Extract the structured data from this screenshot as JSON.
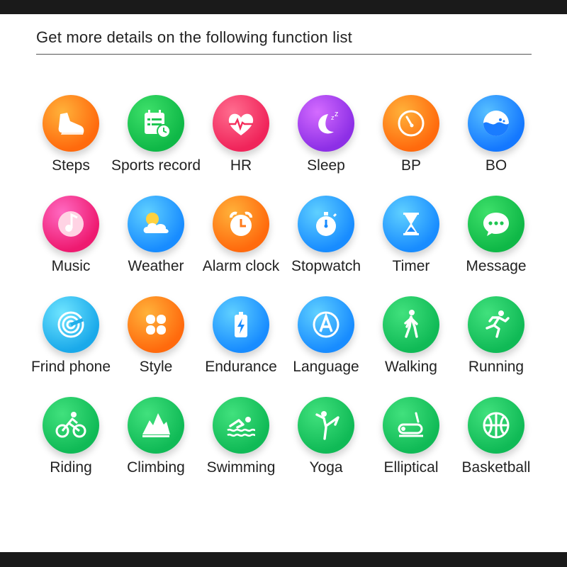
{
  "header": {
    "title": "Get more details on the following function list"
  },
  "functions": [
    {
      "label": "Steps",
      "icon": "shoe-icon",
      "color": "#ff7a1a"
    },
    {
      "label": "Sports record",
      "icon": "calendar-record-icon",
      "color": "#1fc652"
    },
    {
      "label": "HR",
      "icon": "heart-rate-icon",
      "color": "#f42d5c"
    },
    {
      "label": "Sleep",
      "icon": "moon-sleep-icon",
      "color": "#a23df0"
    },
    {
      "label": "BP",
      "icon": "gauge-icon",
      "color": "#ff7a1a"
    },
    {
      "label": "BO",
      "icon": "blood-oxygen-icon",
      "color": "#1a7cff"
    },
    {
      "label": "Music",
      "icon": "music-note-icon",
      "color": "#f02478"
    },
    {
      "label": "Weather",
      "icon": "sun-cloud-icon",
      "color": "#2a95ff"
    },
    {
      "label": "Alarm clock",
      "icon": "alarm-clock-icon",
      "color": "#ff7a1a"
    },
    {
      "label": "Stopwatch",
      "icon": "stopwatch-icon",
      "color": "#1a8cff"
    },
    {
      "label": "Timer",
      "icon": "hourglass-icon",
      "color": "#1a8cff"
    },
    {
      "label": "Message",
      "icon": "chat-bubble-icon",
      "color": "#1fc652"
    },
    {
      "label": "Frind phone",
      "icon": "radar-icon",
      "color": "#22aeea"
    },
    {
      "label": "Style",
      "icon": "clover-icon",
      "color": "#ff6a0d"
    },
    {
      "label": "Endurance",
      "icon": "battery-icon",
      "color": "#1a8cff"
    },
    {
      "label": "Language",
      "icon": "letter-a-icon",
      "color": "#1a8cff"
    },
    {
      "label": "Walking",
      "icon": "walking-person-icon",
      "color": "#14bf5a"
    },
    {
      "label": "Running",
      "icon": "running-person-icon",
      "color": "#14bf5a"
    },
    {
      "label": "Riding",
      "icon": "cyclist-icon",
      "color": "#14bf5a"
    },
    {
      "label": "Climbing",
      "icon": "mountain-icon",
      "color": "#14bf5a"
    },
    {
      "label": "Swimming",
      "icon": "swimmer-icon",
      "color": "#14bf5a"
    },
    {
      "label": "Yoga",
      "icon": "yoga-pose-icon",
      "color": "#14bf5a"
    },
    {
      "label": "Elliptical",
      "icon": "elliptical-machine-icon",
      "color": "#14bf5a"
    },
    {
      "label": "Basketball",
      "icon": "basketball-icon",
      "color": "#14bf5a"
    }
  ]
}
